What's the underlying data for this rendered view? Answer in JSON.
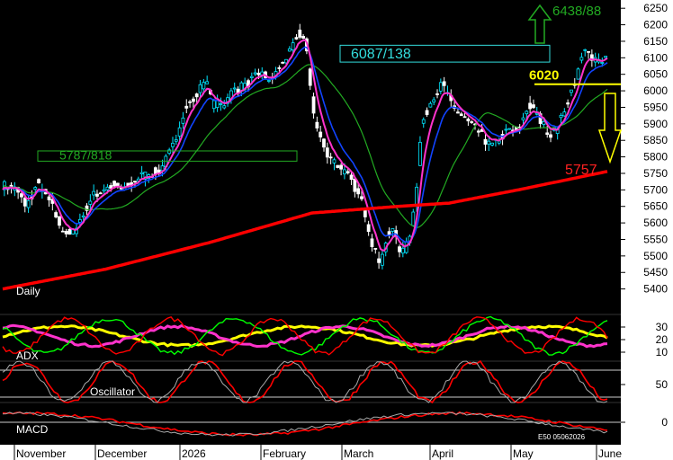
{
  "chart_data": [
    {
      "type": "candlestick",
      "title": "Daily",
      "ylim": [
        5350,
        6275
      ],
      "y_ticks": [
        5400,
        5450,
        5500,
        5550,
        5600,
        5650,
        5700,
        5750,
        5800,
        5850,
        5900,
        5950,
        6000,
        6050,
        6100,
        6150,
        6200,
        6250
      ],
      "x_ticks": [
        "November",
        "December",
        "2026",
        "February",
        "March",
        "April",
        "May",
        "June"
      ],
      "colors": {
        "up": "#00e5ff",
        "down": "#ffffff",
        "ma_fast": "#ff33cc",
        "ma_mid": "#1144ff",
        "ma_slow": "#22aa22",
        "ma_long": "#ff0000"
      },
      "annotations": [
        {
          "text": "5787/818",
          "low": 5787,
          "high": 5818,
          "color": "#22aa22"
        },
        {
          "text": "6087/138",
          "low": 6087,
          "high": 6138,
          "color": "#33dddd"
        },
        {
          "text": "6438/88",
          "color": "#22aa22",
          "arrow": "up"
        },
        {
          "text": "6020",
          "value": 6020,
          "color": "#ffff00",
          "arrow": "down"
        },
        {
          "text": "5757",
          "value": 5757,
          "color": "#ff2222"
        }
      ],
      "source_note": "E50 05062026"
    },
    {
      "type": "line",
      "title": "ADX",
      "y_ticks": [
        10,
        20,
        30
      ],
      "series": [
        {
          "color": "#ffff00"
        },
        {
          "color": "#ff33cc"
        },
        {
          "color": "#00ff00"
        },
        {
          "color": "#ff0000"
        }
      ]
    },
    {
      "type": "line",
      "title": "Oscillator",
      "y_ticks": [
        50
      ],
      "series": [
        {
          "color": "#ff0000"
        },
        {
          "color": "#aaaaaa"
        }
      ]
    },
    {
      "type": "line",
      "title": "MACD",
      "y_ticks": [
        0
      ],
      "series": [
        {
          "color": "#ff0000"
        },
        {
          "color": "#aaaaaa"
        }
      ]
    }
  ]
}
